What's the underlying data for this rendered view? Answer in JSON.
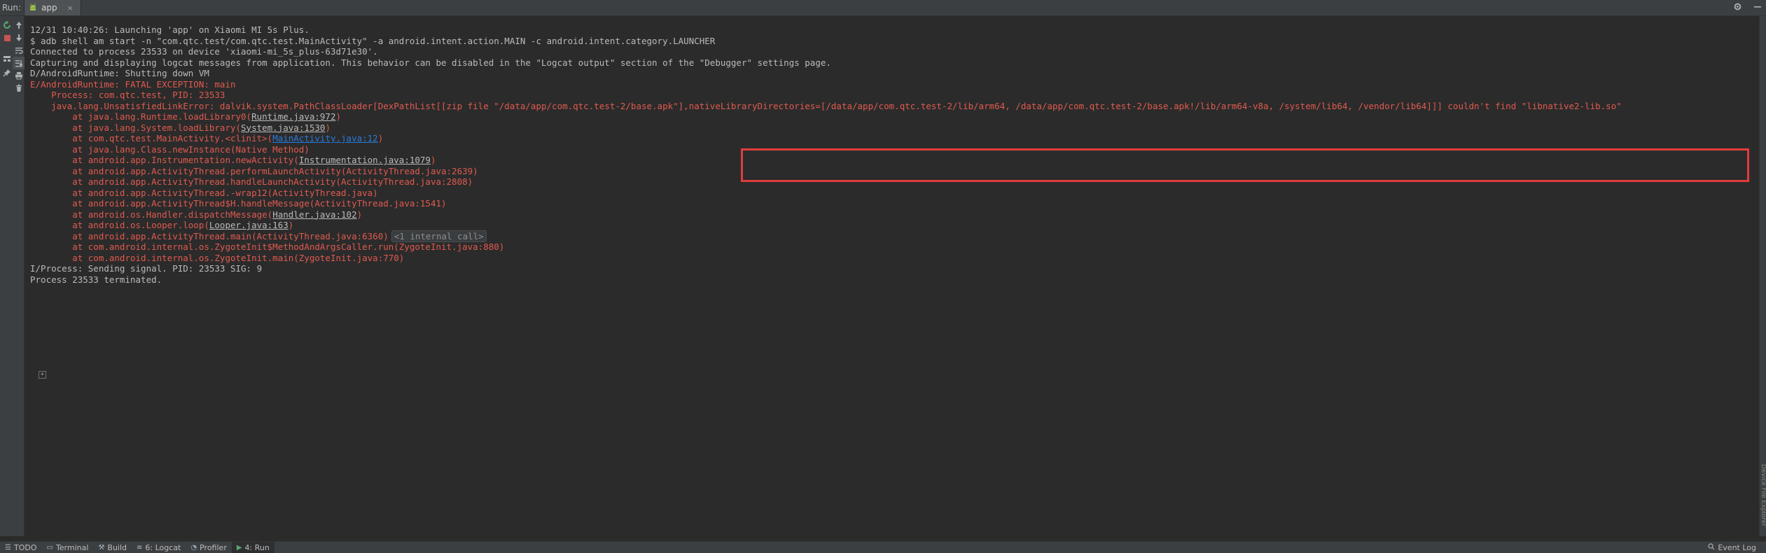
{
  "run_bar": {
    "label": "Run:",
    "tab_name": "app",
    "close": "×",
    "settings_icon": "gear-icon",
    "minimize_icon": "minimize-icon"
  },
  "toolbar_icons": [
    "rerun-icon",
    "stop-icon",
    "scroll-up-icon",
    "scroll-down-icon",
    "soft-wrap-icon",
    "scroll-to-end-icon",
    "restore-layout-icon",
    "pin-icon",
    "print-icon",
    "trash-icon"
  ],
  "console": {
    "lines": [
      {
        "text": "12/31 10:40:26: Launching 'app' on Xiaomi MI 5s Plus.",
        "style": "info"
      },
      {
        "text": "$ adb shell am start -n \"com.qtc.test/com.qtc.test.MainActivity\" -a android.intent.action.MAIN -c android.intent.category.LAUNCHER",
        "style": "info"
      },
      {
        "text": "Connected to process 23533 on device 'xiaomi-mi_5s_plus-63d71e30'.",
        "style": "info"
      },
      {
        "text": "Capturing and displaying logcat messages from application. This behavior can be disabled in the \"Logcat output\" section of the \"Debugger\" settings page.",
        "style": "info"
      },
      {
        "text": "D/AndroidRuntime: Shutting down VM",
        "style": "info"
      },
      {
        "text": "E/AndroidRuntime: FATAL EXCEPTION: main",
        "style": "err"
      },
      {
        "text": "    Process: com.qtc.test, PID: 23533",
        "style": "err"
      },
      {
        "text": "    java.lang.UnsatisfiedLinkError: dalvik.system.PathClassLoader[DexPathList[[zip file \"/data/app/com.qtc.test-2/base.apk\"],nativeLibraryDirectories=[/data/app/com.qtc.test-2/lib/arm64, /data/app/com.qtc.test-2/base.apk!/lib/arm64-v8a, /system/lib64, /vendor/lib64]]] couldn't find \"libnative2-lib.so\"",
        "style": "err"
      },
      {
        "prefix": "        at java.lang.Runtime.loadLibrary0(",
        "link": "Runtime.java:972",
        "suffix": ")",
        "style": "err"
      },
      {
        "prefix": "        at java.lang.System.loadLibrary(",
        "link": "System.java:1530",
        "suffix": ")",
        "style": "err"
      },
      {
        "prefix": "        at com.qtc.test.MainActivity.<clinit>(",
        "link": "MainActivity.java:12",
        "suffix": ")",
        "style": "err",
        "link_blue": true
      },
      {
        "text": "        at java.lang.Class.newInstance(Native Method)",
        "style": "err"
      },
      {
        "prefix": "        at android.app.Instrumentation.newActivity(",
        "link": "Instrumentation.java:1079",
        "suffix": ")",
        "style": "err"
      },
      {
        "text": "        at android.app.ActivityThread.performLaunchActivity(ActivityThread.java:2639)",
        "style": "err"
      },
      {
        "text": "        at android.app.ActivityThread.handleLaunchActivity(ActivityThread.java:2808)",
        "style": "err"
      },
      {
        "text": "        at android.app.ActivityThread.-wrap12(ActivityThread.java)",
        "style": "err"
      },
      {
        "text": "        at android.app.ActivityThread$H.handleMessage(ActivityThread.java:1541)",
        "style": "err"
      },
      {
        "prefix": "        at android.os.Handler.dispatchMessage(",
        "link": "Handler.java:102",
        "suffix": ")",
        "style": "err"
      },
      {
        "prefix": "        at android.os.Looper.loop(",
        "link": "Looper.java:163",
        "suffix": ")",
        "style": "err"
      },
      {
        "text": "        at android.app.ActivityThread.main(ActivityThread.java:6360)",
        "fold": "<1 internal call>",
        "style": "err"
      },
      {
        "text": "        at com.android.internal.os.ZygoteInit$MethodAndArgsCaller.run(ZygoteInit.java:880)",
        "style": "err"
      },
      {
        "text": "        at com.android.internal.os.ZygoteInit.main(ZygoteInit.java:770)",
        "style": "err"
      },
      {
        "text": "I/Process: Sending signal. PID: 23533 SIG: 9",
        "style": "info"
      },
      {
        "text": "Process 23533 terminated.",
        "style": "info"
      }
    ]
  },
  "right_bar_label": "Device File Explorer",
  "bottom_bar": {
    "tabs": [
      {
        "icon": "todo-icon",
        "label": "TODO"
      },
      {
        "icon": "terminal-icon",
        "label": "Terminal"
      },
      {
        "icon": "build-icon",
        "label": "Build"
      },
      {
        "icon": "logcat-icon",
        "label": "6: Logcat"
      },
      {
        "icon": "profiler-icon",
        "label": "Profiler"
      },
      {
        "icon": "run-icon",
        "label": "4: Run"
      }
    ],
    "event_log": "Event Log"
  }
}
